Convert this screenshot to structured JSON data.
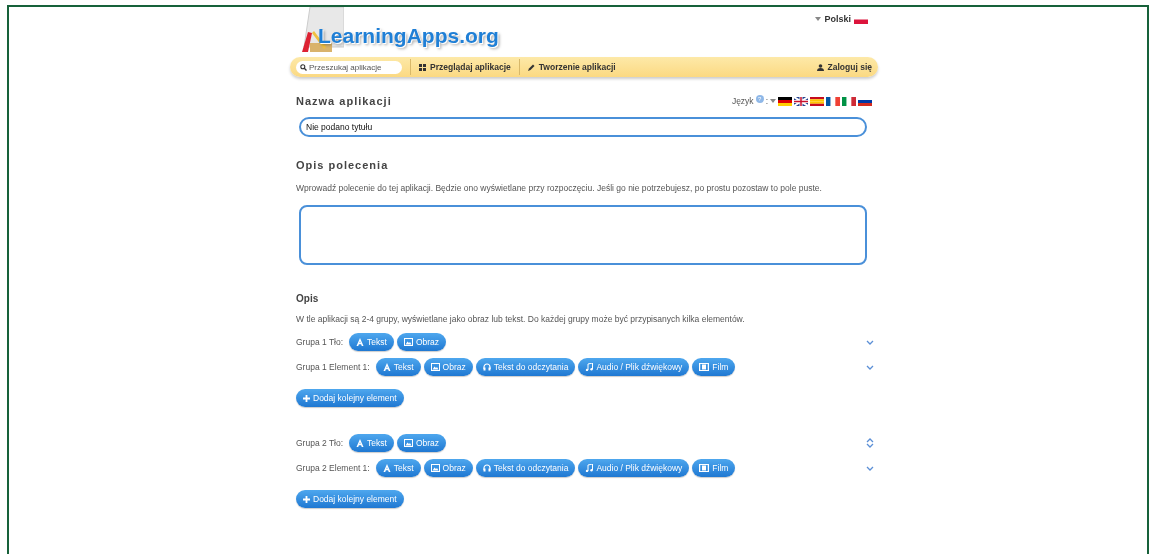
{
  "header": {
    "logo": "LearningApps.org",
    "language": "Polski"
  },
  "nav": {
    "search_placeholder": "Przeszukaj aplikacje",
    "items": [
      "Przeglądaj aplikacje",
      "Tworzenie aplikacji"
    ],
    "login": "Zaloguj się"
  },
  "name_section": {
    "title": "Nazwa aplikacji",
    "language_label": "Język",
    "help": "?",
    "separator": ":",
    "value": "Nie podano tytułu"
  },
  "task_section": {
    "title": "Opis polecenia",
    "description": "Wprowadź polecenie do tej aplikacji. Będzie ono wyświetlane przy rozpoczęciu. Jeśli go nie potrzebujesz, po prostu pozostaw to pole puste."
  },
  "groups_section": {
    "title": "Opis",
    "description": "W tle aplikacji są 2-4 grupy, wyświetlane jako obraz lub tekst. Do każdej grupy może być przypisanych kilka elementów."
  },
  "groups": [
    {
      "rows": [
        {
          "label": "Grupa 1 Tło:",
          "move_up": false,
          "buttons": [
            {
              "kind": "text",
              "label": "Tekst"
            },
            {
              "kind": "image",
              "label": "Obraz"
            }
          ]
        },
        {
          "label": "Grupa 1 Element 1:",
          "move_up": false,
          "buttons": [
            {
              "kind": "text",
              "label": "Tekst"
            },
            {
              "kind": "image",
              "label": "Obraz"
            },
            {
              "kind": "speech",
              "label": "Tekst do odczytania"
            },
            {
              "kind": "audio",
              "label": "Audio / Plik dźwiękowy"
            },
            {
              "kind": "video",
              "label": "Film"
            }
          ]
        }
      ],
      "add": "Dodaj kolejny element"
    },
    {
      "rows": [
        {
          "label": "Grupa 2 Tło:",
          "move_up": true,
          "buttons": [
            {
              "kind": "text",
              "label": "Tekst"
            },
            {
              "kind": "image",
              "label": "Obraz"
            }
          ]
        },
        {
          "label": "Grupa 2 Element 1:",
          "move_up": false,
          "buttons": [
            {
              "kind": "text",
              "label": "Tekst"
            },
            {
              "kind": "image",
              "label": "Obraz"
            },
            {
              "kind": "speech",
              "label": "Tekst do odczytania"
            },
            {
              "kind": "audio",
              "label": "Audio / Plik dźwiękowy"
            },
            {
              "kind": "video",
              "label": "Film"
            }
          ]
        }
      ],
      "add": "Dodaj kolejny element"
    }
  ]
}
